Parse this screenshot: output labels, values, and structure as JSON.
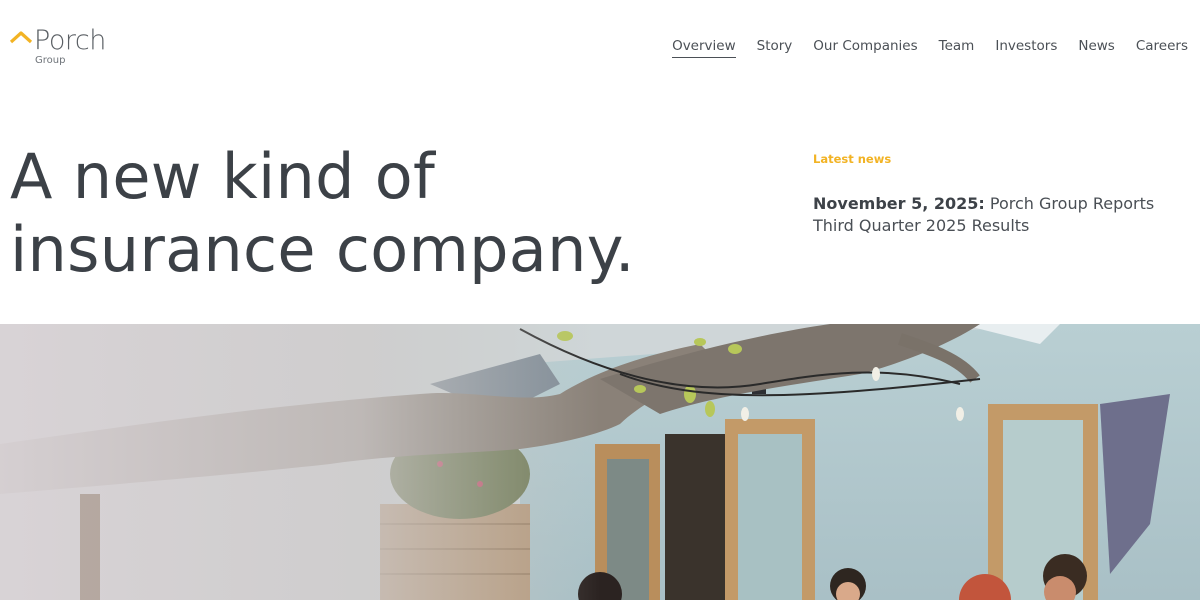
{
  "brand": {
    "name": "Porch",
    "sub": "Group",
    "mark_color": "#F2B324"
  },
  "nav": {
    "items": [
      {
        "label": "Overview",
        "active": true
      },
      {
        "label": "Story",
        "active": false
      },
      {
        "label": "Our Companies",
        "active": false
      },
      {
        "label": "Team",
        "active": false
      },
      {
        "label": "Investors",
        "active": false
      },
      {
        "label": "News",
        "active": false
      },
      {
        "label": "Careers",
        "active": false
      }
    ]
  },
  "hero": {
    "headline_line1": "A new kind of",
    "headline_line2": "insurance company."
  },
  "news": {
    "tag": "Latest news",
    "date": "November 5, 2025:",
    "title": "Porch Group Reports Third Quarter 2025 Results",
    "tag_color": "#F2B324"
  }
}
